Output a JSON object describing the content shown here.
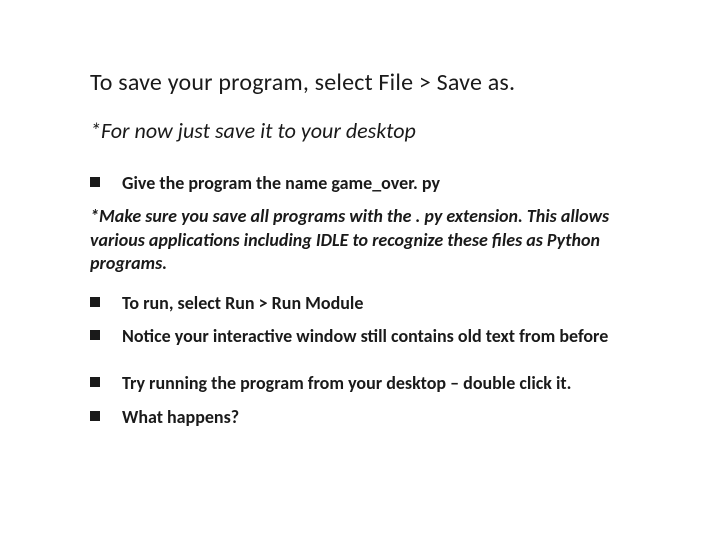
{
  "title": "To save your program, select File > Save as.",
  "subtitle": "*For now just save it to your desktop",
  "bullets_a": [
    "Give the program the name game_over. py"
  ],
  "note": "*Make sure you save all programs with the . py extension. This allows various applications including IDLE to recognize these files as Python programs.",
  "bullets_b": [
    "To run, select Run > Run Module",
    "Notice your interactive window still contains old text from before"
  ],
  "bullets_c": [
    "Try running the program from your desktop – double click it.",
    "What happens?"
  ]
}
